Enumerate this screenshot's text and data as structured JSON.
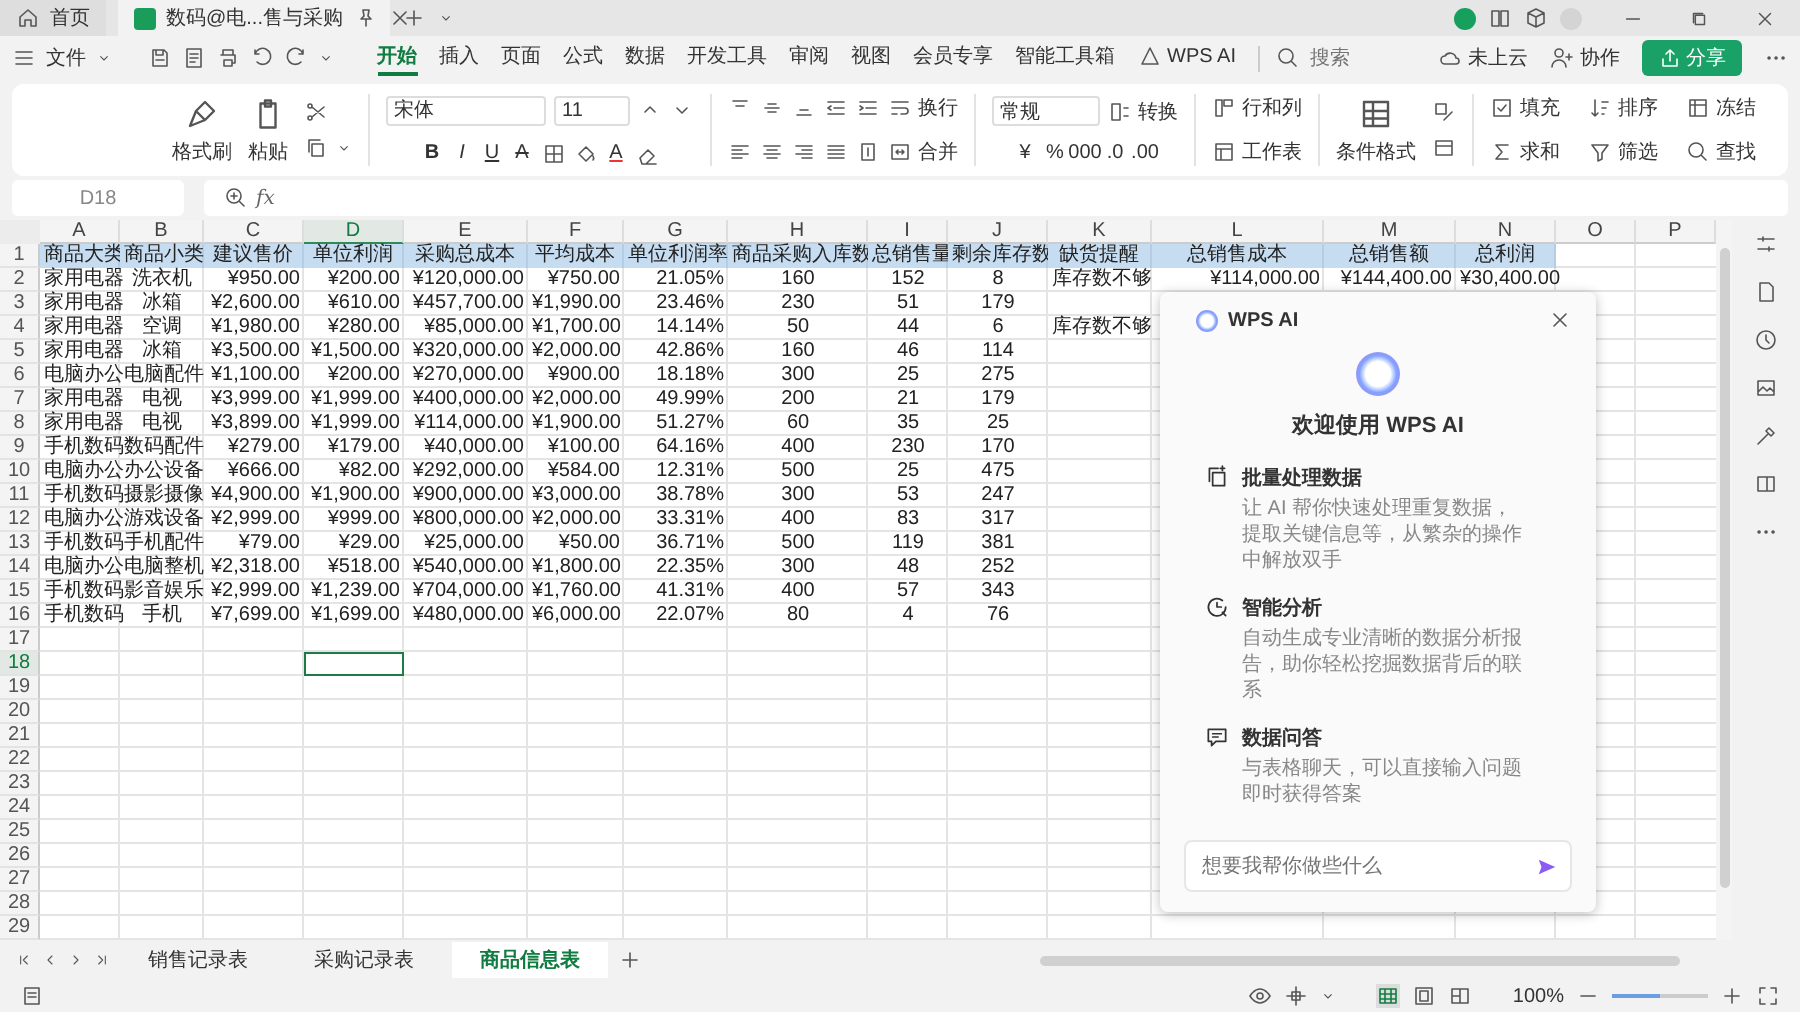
{
  "title_bar": {
    "tabs": [
      {
        "label": "首页",
        "kind": "home",
        "selected": false
      },
      {
        "label": "数码@电...售与采购",
        "kind": "sheet",
        "selected": true
      }
    ]
  },
  "menu": {
    "file_label": "文件",
    "tabs": [
      {
        "label": "开始",
        "selected": true,
        "kind": "text"
      },
      {
        "label": "插入",
        "selected": false,
        "kind": "text"
      },
      {
        "label": "页面",
        "selected": false,
        "kind": "text"
      },
      {
        "label": "公式",
        "selected": false,
        "kind": "text"
      },
      {
        "label": "数据",
        "selected": false,
        "kind": "text"
      },
      {
        "label": "开发工具",
        "selected": false,
        "kind": "text"
      },
      {
        "label": "审阅",
        "selected": false,
        "kind": "text"
      },
      {
        "label": "视图",
        "selected": false,
        "kind": "text"
      },
      {
        "label": "会员专享",
        "selected": false,
        "kind": "text"
      },
      {
        "label": "智能工具箱",
        "selected": false,
        "kind": "text"
      },
      {
        "label": "WPS AI",
        "selected": false,
        "kind": "ai"
      }
    ],
    "search_placeholder": "搜索",
    "cloud_label": "未上云",
    "collab_label": "协作",
    "share_label": "分享"
  },
  "ribbon": {
    "clipboard": {
      "format_painter": "格式刷",
      "paste": "粘贴"
    },
    "font": {
      "name": "宋体",
      "size": "11",
      "styles": [
        "B",
        "I",
        "U",
        "A"
      ],
      "font_color": "A"
    },
    "alignment": {
      "wrap": "换行",
      "merge": "合并"
    },
    "number": {
      "format": "常规",
      "convert": "转换",
      "symbols": [
        "¥",
        "%",
        "000",
        ".0",
        ".00"
      ]
    },
    "cells": {
      "rows_cols": "行和列",
      "worksheet": "工作表"
    },
    "styles": {
      "conditional": "条件格式"
    },
    "editing": [
      {
        "label": "填充",
        "kind": "fill"
      },
      {
        "label": "排序",
        "kind": "sort"
      },
      {
        "label": "冻结",
        "kind": "freeze"
      },
      {
        "label": "求和",
        "kind": "sum"
      },
      {
        "label": "筛选",
        "kind": "filter"
      },
      {
        "label": "查找",
        "kind": "find"
      }
    ]
  },
  "formula_bar": {
    "name_box": "D18",
    "fx_label": "fx"
  },
  "sheet": {
    "columns": [
      {
        "label": "A",
        "selected": false
      },
      {
        "label": "B",
        "selected": false
      },
      {
        "label": "C",
        "selected": false
      },
      {
        "label": "D",
        "selected": true
      },
      {
        "label": "E",
        "selected": false
      },
      {
        "label": "F",
        "selected": false
      },
      {
        "label": "G",
        "selected": false
      },
      {
        "label": "H",
        "selected": false
      },
      {
        "label": "I",
        "selected": false
      },
      {
        "label": "J",
        "selected": false
      },
      {
        "label": "K",
        "selected": false
      },
      {
        "label": "L",
        "selected": false
      },
      {
        "label": "M",
        "selected": false
      },
      {
        "label": "N",
        "selected": false
      },
      {
        "label": "O",
        "selected": false
      },
      {
        "label": "P",
        "selected": false
      }
    ],
    "header": {
      "number": "1",
      "cells": [
        "商品大类",
        "商品小类",
        "建议售价",
        "单位利润",
        "采购总成本",
        "平均成本",
        "单位利润率",
        "商品采购入库数",
        "总销售量",
        "剩余库存数"
      ],
      "alert": "缺货提醒",
      "totals": [
        "总销售成本",
        "总销售额",
        "总利润"
      ]
    },
    "rows": [
      {
        "number": "2",
        "kind": "data",
        "selected": false,
        "cells": [
          "家用电器",
          "洗衣机",
          "¥950.00",
          "¥200.00",
          "¥120,000.00",
          "¥750.00",
          "21.05%",
          "160",
          "152",
          "8"
        ],
        "alert": "库存数不够",
        "totals": [
          "¥114,000.00",
          "¥144,400.00",
          "¥30,400.00"
        ]
      },
      {
        "number": "3",
        "kind": "data",
        "selected": false,
        "cells": [
          "家用电器",
          "冰箱",
          "¥2,600.00",
          "¥610.00",
          "¥457,700.00",
          "¥1,990.00",
          "23.46%",
          "230",
          "51",
          "179"
        ]
      },
      {
        "number": "4",
        "kind": "data",
        "selected": false,
        "cells": [
          "家用电器",
          "空调",
          "¥1,980.00",
          "¥280.00",
          "¥85,000.00",
          "¥1,700.00",
          "14.14%",
          "50",
          "44",
          "6"
        ],
        "alert": "库存数不够"
      },
      {
        "number": "5",
        "kind": "data",
        "selected": false,
        "cells": [
          "家用电器",
          "冰箱",
          "¥3,500.00",
          "¥1,500.00",
          "¥320,000.00",
          "¥2,000.00",
          "42.86%",
          "160",
          "46",
          "114"
        ]
      },
      {
        "number": "6",
        "kind": "data",
        "selected": false,
        "cells": [
          "电脑办公",
          "电脑配件",
          "¥1,100.00",
          "¥200.00",
          "¥270,000.00",
          "¥900.00",
          "18.18%",
          "300",
          "25",
          "275"
        ]
      },
      {
        "number": "7",
        "kind": "data",
        "selected": false,
        "cells": [
          "家用电器",
          "电视",
          "¥3,999.00",
          "¥1,999.00",
          "¥400,000.00",
          "¥2,000.00",
          "49.99%",
          "200",
          "21",
          "179"
        ]
      },
      {
        "number": "8",
        "kind": "data",
        "selected": false,
        "cells": [
          "家用电器",
          "电视",
          "¥3,899.00",
          "¥1,999.00",
          "¥114,000.00",
          "¥1,900.00",
          "51.27%",
          "60",
          "35",
          "25"
        ]
      },
      {
        "number": "9",
        "kind": "data",
        "selected": false,
        "cells": [
          "手机数码",
          "数码配件",
          "¥279.00",
          "¥179.00",
          "¥40,000.00",
          "¥100.00",
          "64.16%",
          "400",
          "230",
          "170"
        ]
      },
      {
        "number": "10",
        "kind": "data",
        "selected": false,
        "cells": [
          "电脑办公",
          "办公设备",
          "¥666.00",
          "¥82.00",
          "¥292,000.00",
          "¥584.00",
          "12.31%",
          "500",
          "25",
          "475"
        ]
      },
      {
        "number": "11",
        "kind": "data",
        "selected": false,
        "cells": [
          "手机数码",
          "摄影摄像",
          "¥4,900.00",
          "¥1,900.00",
          "¥900,000.00",
          "¥3,000.00",
          "38.78%",
          "300",
          "53",
          "247"
        ]
      },
      {
        "number": "12",
        "kind": "data",
        "selected": false,
        "cells": [
          "电脑办公",
          "游戏设备",
          "¥2,999.00",
          "¥999.00",
          "¥800,000.00",
          "¥2,000.00",
          "33.31%",
          "400",
          "83",
          "317"
        ]
      },
      {
        "number": "13",
        "kind": "data",
        "selected": false,
        "cells": [
          "手机数码",
          "手机配件",
          "¥79.00",
          "¥29.00",
          "¥25,000.00",
          "¥50.00",
          "36.71%",
          "500",
          "119",
          "381"
        ]
      },
      {
        "number": "14",
        "kind": "data",
        "selected": false,
        "cells": [
          "电脑办公",
          "电脑整机",
          "¥2,318.00",
          "¥518.00",
          "¥540,000.00",
          "¥1,800.00",
          "22.35%",
          "300",
          "48",
          "252"
        ]
      },
      {
        "number": "15",
        "kind": "data",
        "selected": false,
        "cells": [
          "手机数码",
          "影音娱乐",
          "¥2,999.00",
          "¥1,239.00",
          "¥704,000.00",
          "¥1,760.00",
          "41.31%",
          "400",
          "57",
          "343"
        ]
      },
      {
        "number": "16",
        "kind": "data",
        "selected": false,
        "cells": [
          "手机数码",
          "手机",
          "¥7,699.00",
          "¥1,699.00",
          "¥480,000.00",
          "¥6,000.00",
          "22.07%",
          "80",
          "4",
          "76"
        ]
      },
      {
        "number": "17",
        "kind": "data",
        "selected": false
      },
      {
        "number": "18",
        "kind": "data",
        "selected": true
      },
      {
        "number": "19",
        "kind": "data",
        "selected": false
      },
      {
        "number": "20",
        "kind": "data",
        "selected": false
      },
      {
        "number": "21",
        "kind": "data",
        "selected": false
      },
      {
        "number": "22",
        "kind": "data",
        "selected": false
      },
      {
        "number": "23",
        "kind": "data",
        "selected": false
      },
      {
        "number": "24",
        "kind": "data",
        "selected": false
      },
      {
        "number": "25",
        "kind": "data",
        "selected": false
      },
      {
        "number": "26",
        "kind": "data",
        "selected": false
      },
      {
        "number": "27",
        "kind": "data",
        "selected": false
      },
      {
        "number": "28",
        "kind": "data",
        "selected": false
      },
      {
        "number": "29",
        "kind": "data",
        "selected": false
      }
    ]
  },
  "ai_panel": {
    "title": "WPS AI",
    "welcome": "欢迎使用 WPS AI",
    "features": [
      {
        "kind": "batch",
        "title": "批量处理数据",
        "description": "让 AI 帮你快速处理重复数据，提取关键信息等，从繁杂的操作中解放双手"
      },
      {
        "kind": "analysis",
        "title": "智能分析",
        "description": "自动生成专业清晰的数据分析报告，助你轻松挖掘数据背后的联系"
      },
      {
        "kind": "qa",
        "title": "数据问答",
        "description": "与表格聊天，可以直接输入问题即时获得答案"
      }
    ],
    "input_placeholder": "想要我帮你做些什么"
  },
  "sheet_tabs": [
    {
      "label": "销售记录表",
      "selected": false
    },
    {
      "label": "采购记录表",
      "selected": false
    },
    {
      "label": "商品信息表",
      "selected": true
    }
  ],
  "status_bar": {
    "views": [
      {
        "kind": "normal",
        "selected": true
      },
      {
        "kind": "page",
        "selected": false
      },
      {
        "kind": "break",
        "selected": false
      }
    ],
    "zoom": {
      "label": "100%",
      "level": 0.5
    }
  }
}
